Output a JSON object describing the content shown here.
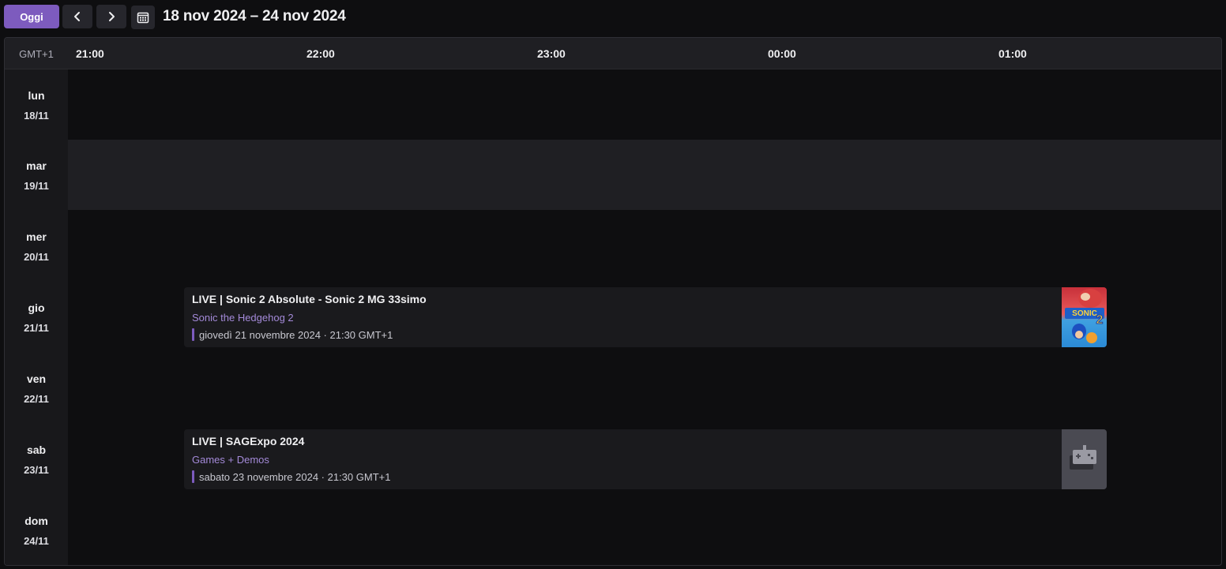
{
  "toolbar": {
    "today_label": "Oggi",
    "range_title": "18 nov 2024 – 24 nov 2024"
  },
  "calendar": {
    "timezone": "GMT+1",
    "hours": [
      "21:00",
      "22:00",
      "23:00",
      "00:00",
      "01:00"
    ],
    "days": [
      {
        "name": "lun",
        "date": "18/11"
      },
      {
        "name": "mar",
        "date": "19/11"
      },
      {
        "name": "mer",
        "date": "20/11"
      },
      {
        "name": "gio",
        "date": "21/11"
      },
      {
        "name": "ven",
        "date": "22/11"
      },
      {
        "name": "sab",
        "date": "23/11"
      },
      {
        "name": "dom",
        "date": "24/11"
      }
    ],
    "today_day": "mar",
    "events": [
      {
        "title": "LIVE | Sonic 2 Absolute - Sonic 2 MG 33simo",
        "category": "Sonic the Hedgehog 2",
        "time": "giovedì 21 novembre 2024 · 21:30 GMT+1",
        "thumb_logo_lines": [
          "SONIC",
          "2"
        ]
      },
      {
        "title": "LIVE | SAGExpo 2024",
        "category": "Games + Demos",
        "time": "sabato 23 novembre 2024 · 21:30 GMT+1",
        "thumb": "controller-placeholder-icon"
      }
    ]
  },
  "colors": {
    "accent": "#7d5bbe",
    "category_text": "#a48ad9",
    "background": "#0e0e10"
  }
}
